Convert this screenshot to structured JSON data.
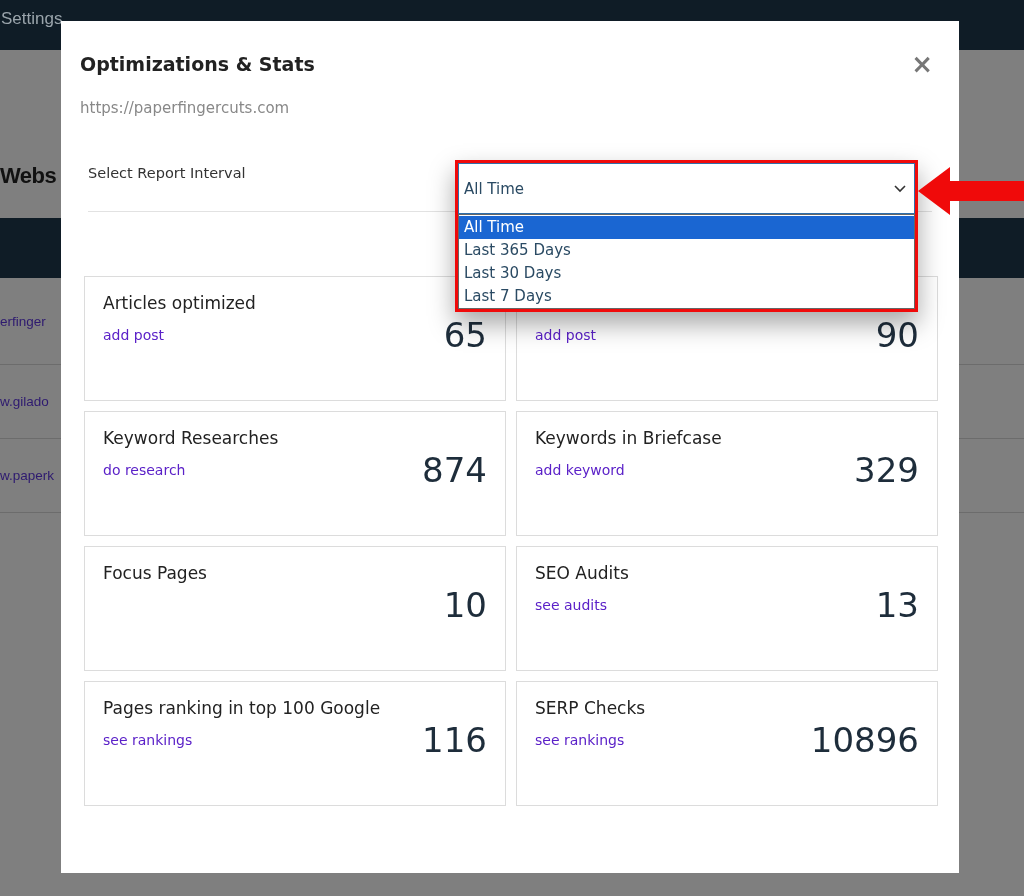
{
  "page": {
    "nav_item": "Settings",
    "heading": "Webs",
    "rows": [
      {
        "link": "erfinger"
      },
      {
        "link": "w.gilado"
      },
      {
        "link": "w.paperk"
      }
    ]
  },
  "modal": {
    "title": "Optimizations & Stats",
    "close": "×",
    "url": "https://paperfingercuts.com",
    "interval": {
      "label": "Select Report Interval",
      "value": "All Time",
      "options": [
        {
          "label": "All Time",
          "selected": true
        },
        {
          "label": "Last 365 Days",
          "selected": false
        },
        {
          "label": "Last 30 Days",
          "selected": false
        },
        {
          "label": "Last 7 Days",
          "selected": false
        }
      ]
    },
    "cards": [
      {
        "title": "Articles optimized",
        "value": "65",
        "link": "add post"
      },
      {
        "value": "90",
        "link": "add post"
      },
      {
        "title": "Keyword Researches",
        "value": "874",
        "link": "do research"
      },
      {
        "title": "Keywords in Briefcase",
        "value": "329",
        "link": "add keyword"
      },
      {
        "title": "Focus Pages",
        "value": "10"
      },
      {
        "title": "SEO Audits",
        "value": "13",
        "link": "see audits"
      },
      {
        "title": "Pages ranking in top 100 Google",
        "value": "116",
        "link": "see rankings"
      },
      {
        "title": "SERP Checks",
        "value": "10896",
        "link": "see rankings"
      }
    ]
  }
}
